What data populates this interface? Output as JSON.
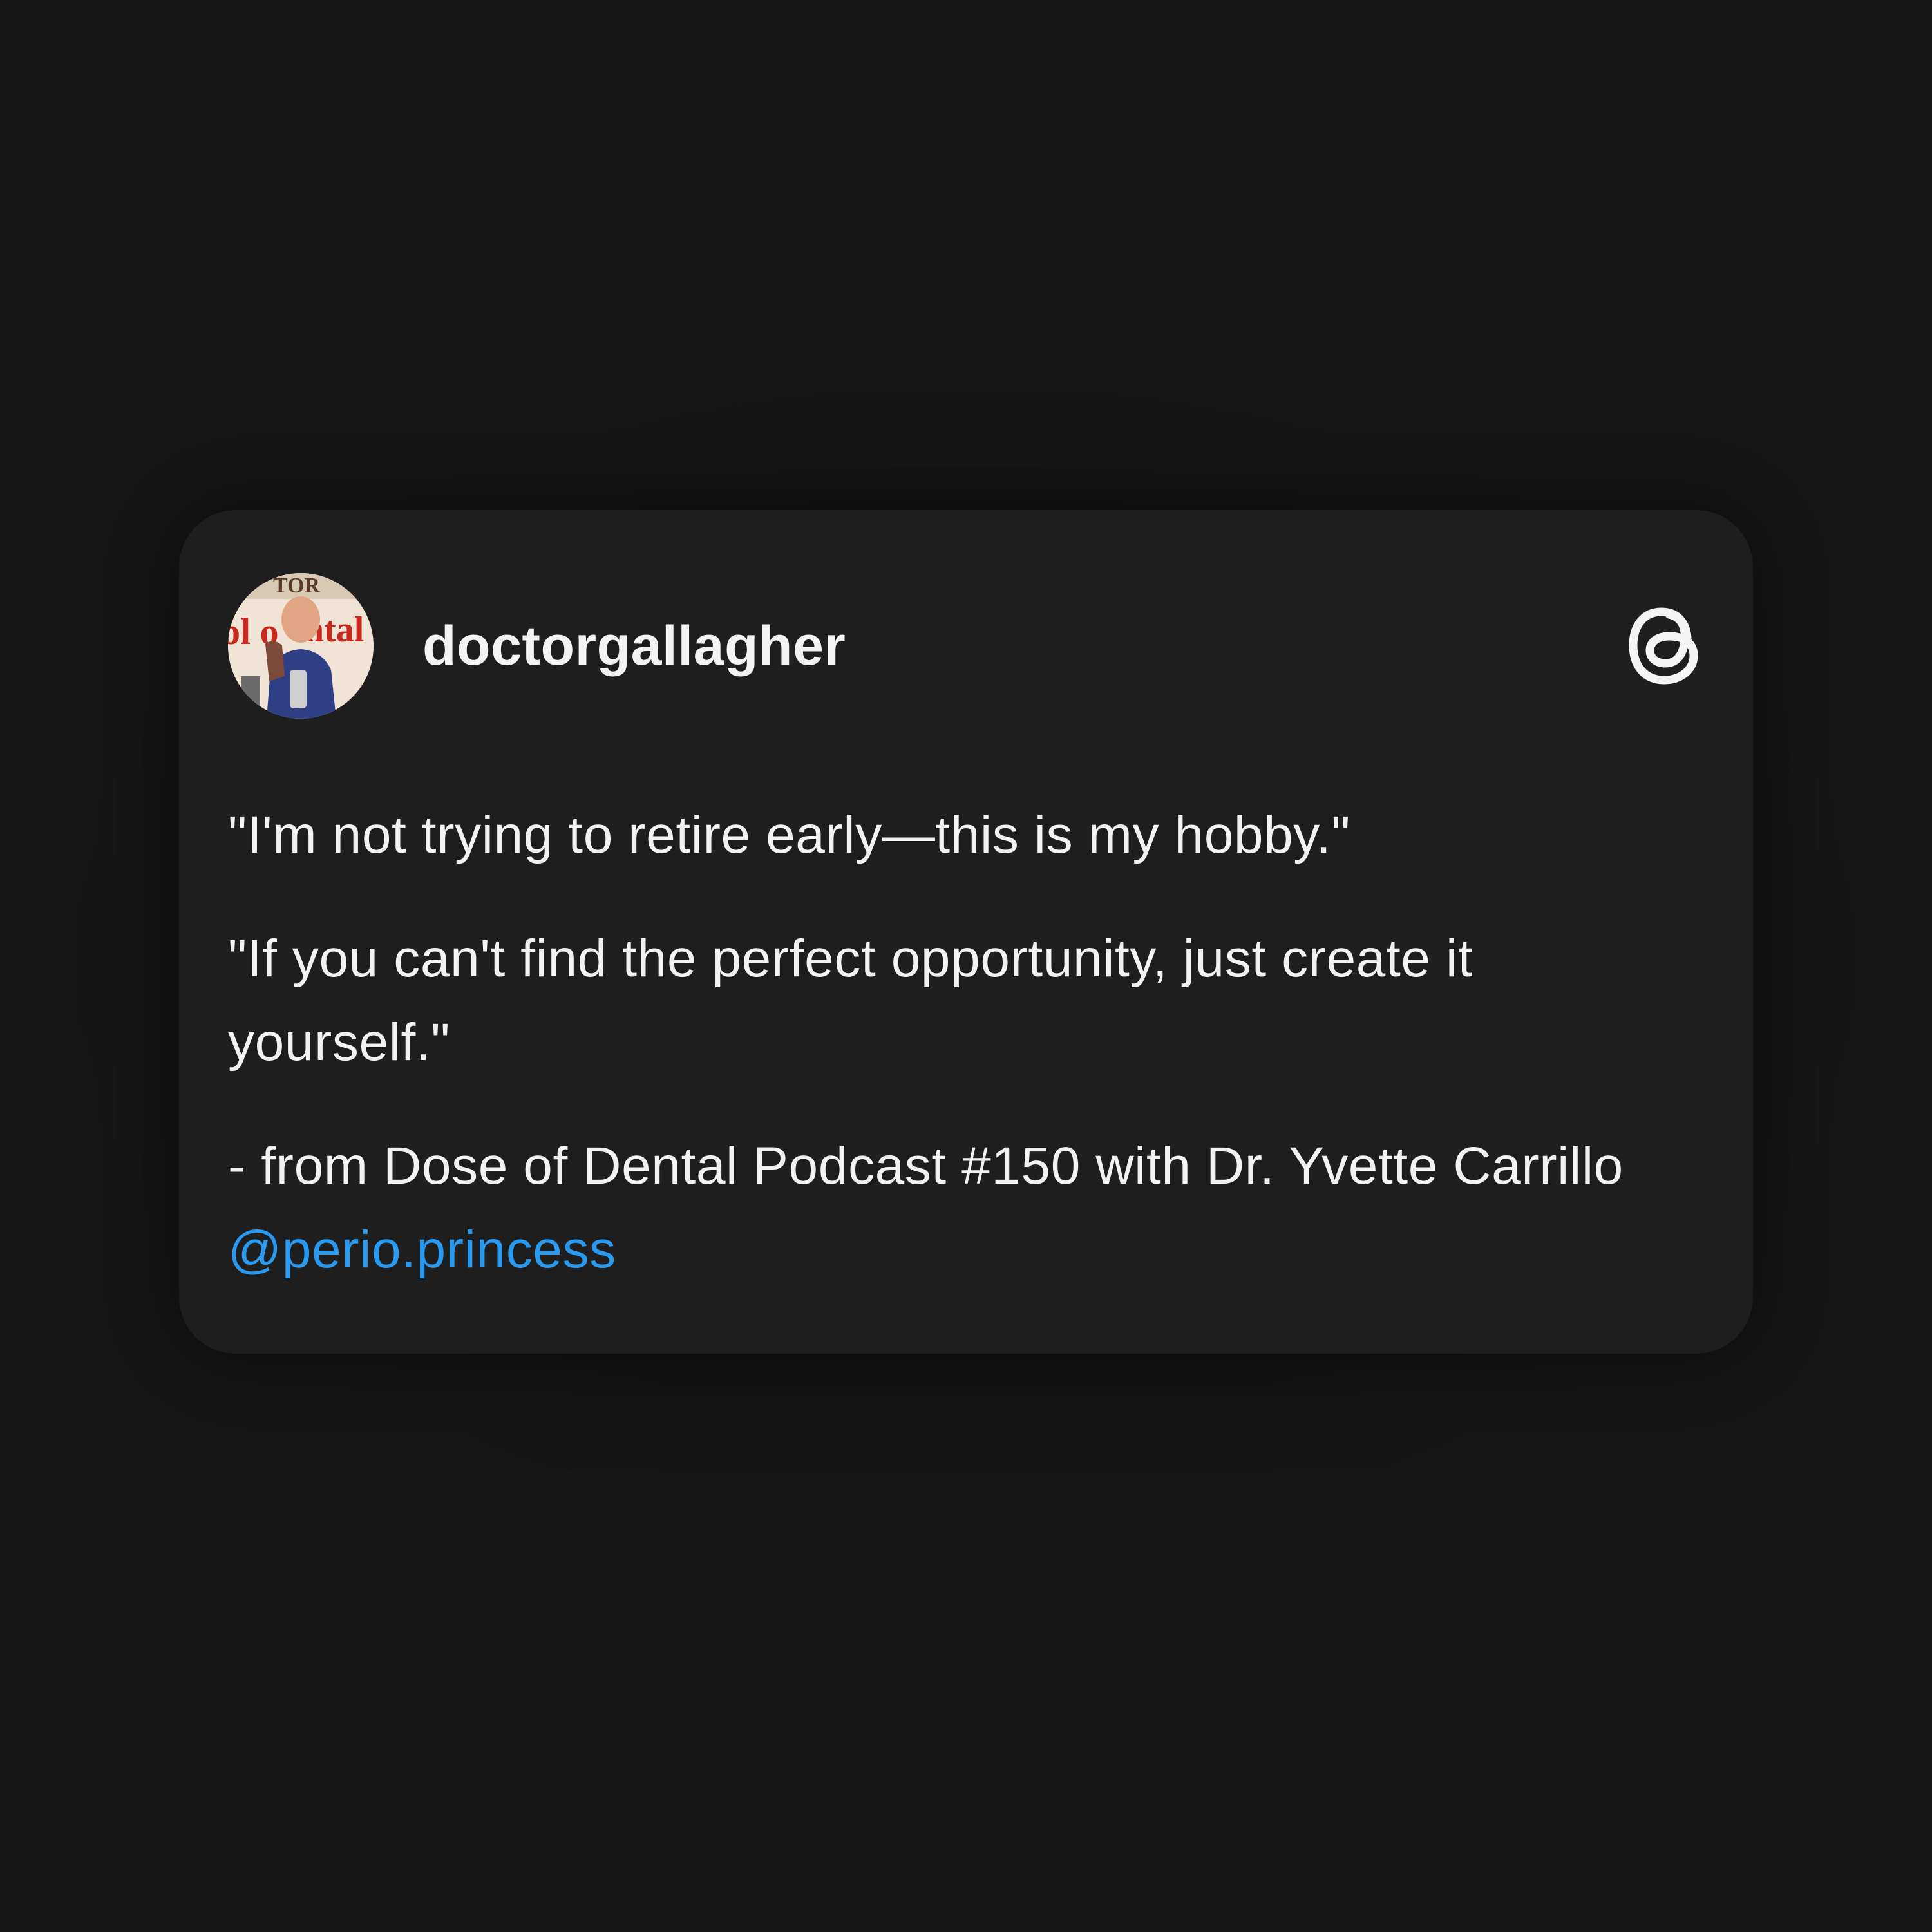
{
  "post": {
    "username": "doctorgallagher",
    "avatar_icon": "profile-photo",
    "platform_icon": "threads-logo-icon",
    "paragraphs": [
      "\"I'm not trying to retire early—this is my hobby.\"",
      "\"If you can't find the perfect opportunity, just create it yourself.\""
    ],
    "credit_text": "- from Dose of Dental Podcast #150 with Dr. Yvette Carrillo ",
    "mention": "@perio.princess"
  },
  "colors": {
    "background": "#181818",
    "card": "#1e1e1e",
    "text": "#f2f2f2",
    "mention": "#2a9af0"
  }
}
